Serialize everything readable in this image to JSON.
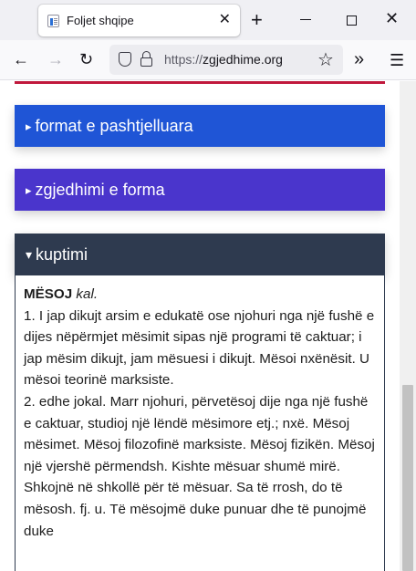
{
  "browser": {
    "tab_title": "Foljet shqipe",
    "tab_close": "✕",
    "new_tab": "+",
    "win_close": "✕",
    "url_scheme": "https://",
    "url_host": "zgjedhime.org",
    "back": "←",
    "forward": "→",
    "reload": "↻",
    "star": "☆",
    "overflow": "»",
    "menu": "☰"
  },
  "sections": [
    {
      "arrow": "▸",
      "label": "format e pashtjelluara"
    },
    {
      "arrow": "▸",
      "label": "zgjedhimi e forma"
    },
    {
      "arrow": "▾",
      "label": "kuptimi"
    }
  ],
  "entry": {
    "headword": "MËSOJ",
    "pos": "kal.",
    "text1": "1. I jap dikujt arsim e edukatë ose njohuri nga një fushë e dijes nëpërmjet mësimit sipas një programi të caktuar; i jap mësim dikujt, jam mësuesi i dikujt. Mësoi nxënësit. U mësoi teorinë marksiste.",
    "text2": "2. edhe jokal. Marr njohuri, përvetësoj dije nga një fushë e caktuar, studioj një lëndë mësimore etj.; nxë. Mësoj mësimet. Mësoj filozofinë marksiste. Mësoj fizikën. Mësoj një vjershë përmendsh. Kishte mësuar shumë mirë. Shkojnë në shkollë për të mësuar. Sa të rrosh, do të mësosh. fj. u. Të mësojmë duke punuar dhe të punojmë duke"
  },
  "colors": {
    "section1": "#1f55d6",
    "section2": "#4a35cc",
    "section3": "#2e3a4f",
    "accent_red": "#c0183c"
  }
}
